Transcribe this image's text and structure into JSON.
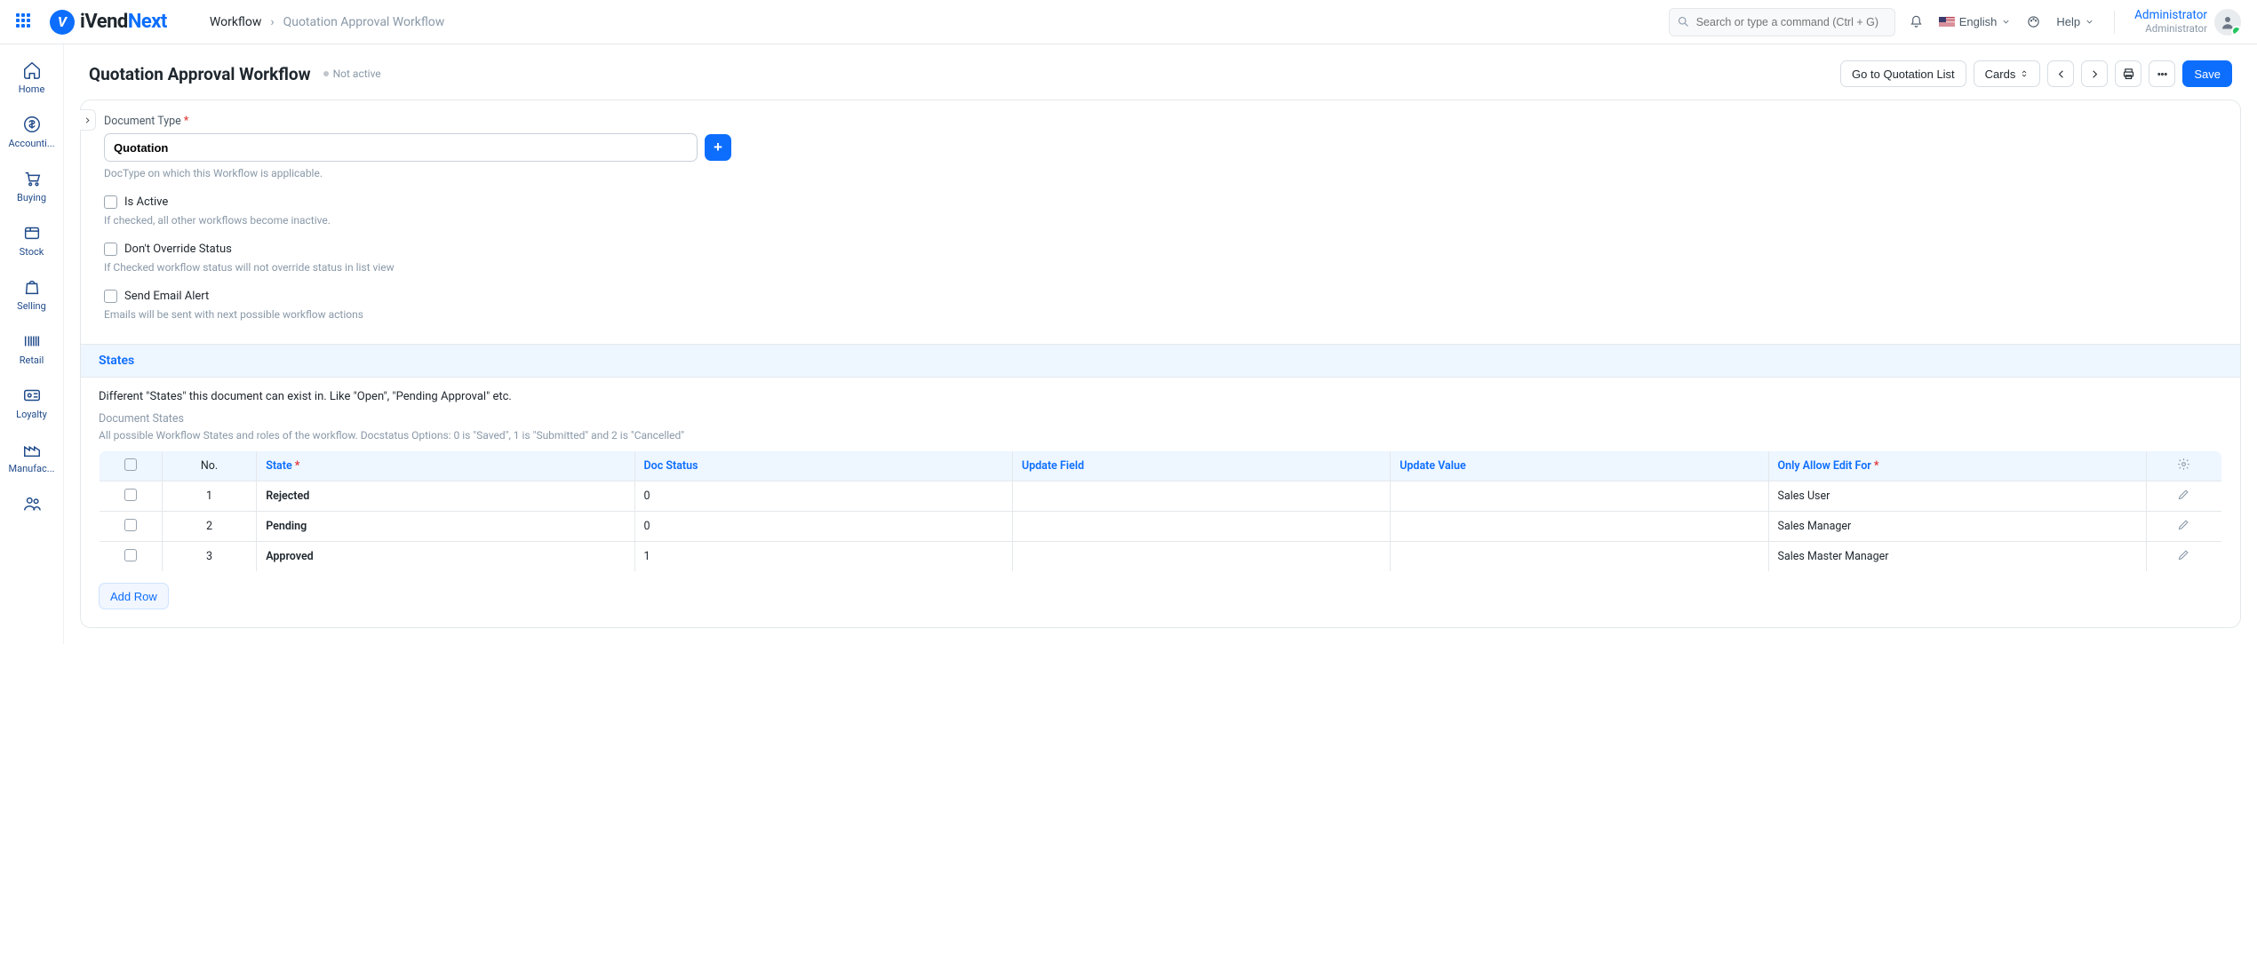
{
  "brand": {
    "name_part1": "iVend",
    "name_part2": "Next"
  },
  "breadcrumb": {
    "root": "Workflow",
    "current": "Quotation Approval Workflow"
  },
  "search": {
    "placeholder": "Search or type a command (Ctrl + G)"
  },
  "top": {
    "language": "English",
    "help": "Help"
  },
  "user": {
    "name": "Administrator",
    "role": "Administrator"
  },
  "sidebar": [
    {
      "label": "Home",
      "icon": "home"
    },
    {
      "label": "Accounti...",
      "icon": "dollar"
    },
    {
      "label": "Buying",
      "icon": "cart"
    },
    {
      "label": "Stock",
      "icon": "box"
    },
    {
      "label": "Selling",
      "icon": "bag"
    },
    {
      "label": "Retail",
      "icon": "barcode"
    },
    {
      "label": "Loyalty",
      "icon": "idcard"
    },
    {
      "label": "Manufac...",
      "icon": "factory"
    },
    {
      "label": "",
      "icon": "users"
    }
  ],
  "page": {
    "title": "Quotation Approval Workflow",
    "status": "Not active",
    "actions": {
      "goto": "Go to Quotation List",
      "cards": "Cards",
      "save": "Save"
    }
  },
  "form": {
    "doc_type_label": "Document Type",
    "doc_type_value": "Quotation",
    "doc_type_help": "DocType on which this Workflow is applicable.",
    "is_active_label": "Is Active",
    "is_active_help": "If checked, all other workflows become inactive.",
    "dont_override_label": "Don't Override Status",
    "dont_override_help": "If Checked workflow status will not override status in list view",
    "send_email_label": "Send Email Alert",
    "send_email_help": "Emails will be sent with next possible workflow actions"
  },
  "states": {
    "heading": "States",
    "desc": "Different \"States\" this document can exist in. Like \"Open\", \"Pending Approval\" etc.",
    "sub_label": "Document States",
    "sub_help": "All possible Workflow States and roles of the workflow. Docstatus Options: 0 is \"Saved\", 1 is \"Submitted\" and 2 is \"Cancelled\"",
    "cols": {
      "no": "No.",
      "state": "State",
      "doc_status": "Doc Status",
      "update_field": "Update Field",
      "update_value": "Update Value",
      "only_allow": "Only Allow Edit For"
    },
    "rows": [
      {
        "no": "1",
        "state": "Rejected",
        "doc_status": "0",
        "update_field": "",
        "update_value": "",
        "only_allow": "Sales User"
      },
      {
        "no": "2",
        "state": "Pending",
        "doc_status": "0",
        "update_field": "",
        "update_value": "",
        "only_allow": "Sales Manager"
      },
      {
        "no": "3",
        "state": "Approved",
        "doc_status": "1",
        "update_field": "",
        "update_value": "",
        "only_allow": "Sales Master Manager"
      }
    ],
    "add_row": "Add Row"
  }
}
